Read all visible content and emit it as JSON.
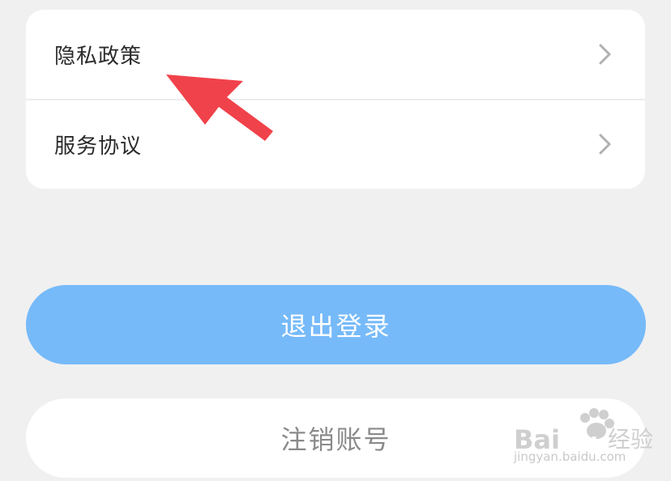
{
  "settings_list": {
    "items": [
      {
        "label": "隐私政策",
        "icon": "chevron-right-icon"
      },
      {
        "label": "服务协议",
        "icon": "chevron-right-icon"
      }
    ]
  },
  "actions": {
    "logout_label": "退出登录",
    "delete_account_label": "注销账号"
  },
  "annotation": {
    "icon": "red-pointer-arrow-icon",
    "color": "#f0424a"
  },
  "watermark": {
    "brand": "Baidu经验",
    "url": "jingyan.baidu.com"
  },
  "colors": {
    "background": "#f0f0f0",
    "card": "#ffffff",
    "primary_button": "#76baf9",
    "secondary_button_text": "#8a8a8a"
  }
}
